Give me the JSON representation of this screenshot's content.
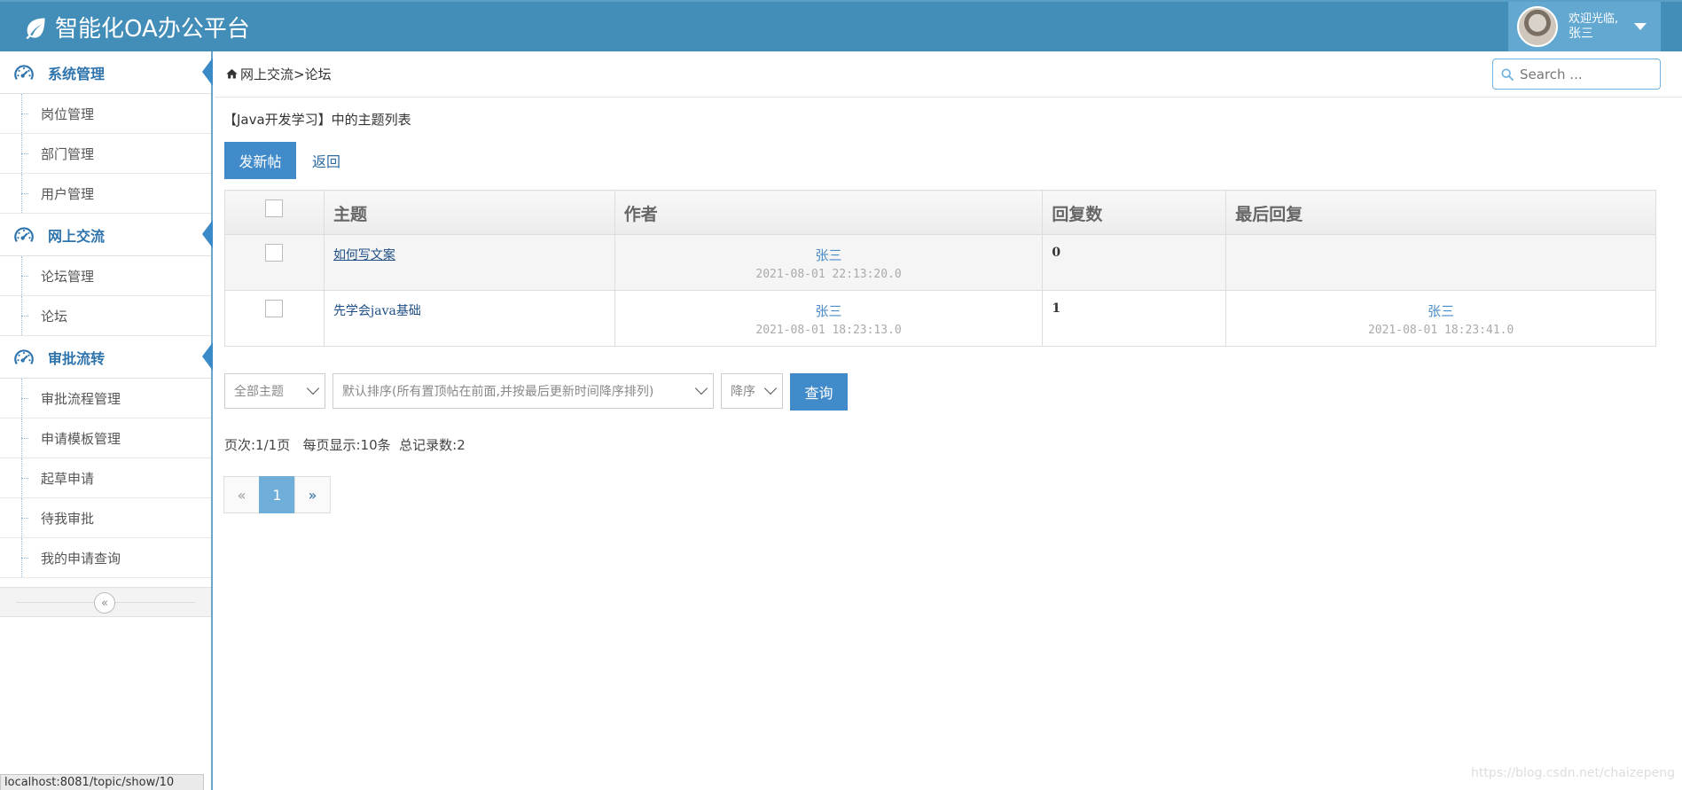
{
  "header": {
    "title": "智能化OA办公平台",
    "welcome": "欢迎光临,",
    "username": "张三"
  },
  "sidebar": {
    "groups": [
      {
        "label": "系统管理",
        "items": [
          "岗位管理",
          "部门管理",
          "用户管理"
        ]
      },
      {
        "label": "网上交流",
        "items": [
          "论坛管理",
          "论坛"
        ]
      },
      {
        "label": "审批流转",
        "items": [
          "审批流程管理",
          "申请模板管理",
          "起草申请",
          "待我审批",
          "我的申请查询"
        ]
      }
    ],
    "collapse_icon": "«"
  },
  "breadcrumb": {
    "path": "网上交流>论坛"
  },
  "search": {
    "placeholder": "Search ..."
  },
  "main": {
    "list_title": "【Java开发学习】中的主题列表",
    "new_post_label": "发新帖",
    "back_label": "返回",
    "columns": [
      "主题",
      "作者",
      "回复数",
      "最后回复"
    ],
    "rows": [
      {
        "topic": "如何写文案",
        "author": "张三",
        "author_time": "2021-08-01 22:13:20.0",
        "replies": "0",
        "last_reply_user": "",
        "last_reply_time": ""
      },
      {
        "topic": "先学会java基础",
        "author": "张三",
        "author_time": "2021-08-01 18:23:13.0",
        "replies": "1",
        "last_reply_user": "张三",
        "last_reply_time": "2021-08-01 18:23:41.0"
      }
    ]
  },
  "filters": {
    "scope": "全部主题",
    "order_by": "默认排序(所有置顶帖在前面,并按最后更新时间降序排列)",
    "direction": "降序",
    "query_label": "查询"
  },
  "paging": {
    "info": "页次:1/1页   每页显示:10条  总记录数:2",
    "prev": "«",
    "current": "1",
    "next": "»"
  },
  "status_bar": "localhost:8081/topic/show/10",
  "watermark": "https://blog.csdn.net/chaizepeng",
  "colors": {
    "navbar": "#438eb9",
    "primary_button": "#428bca",
    "sidebar_heading": "#2f74ad"
  }
}
